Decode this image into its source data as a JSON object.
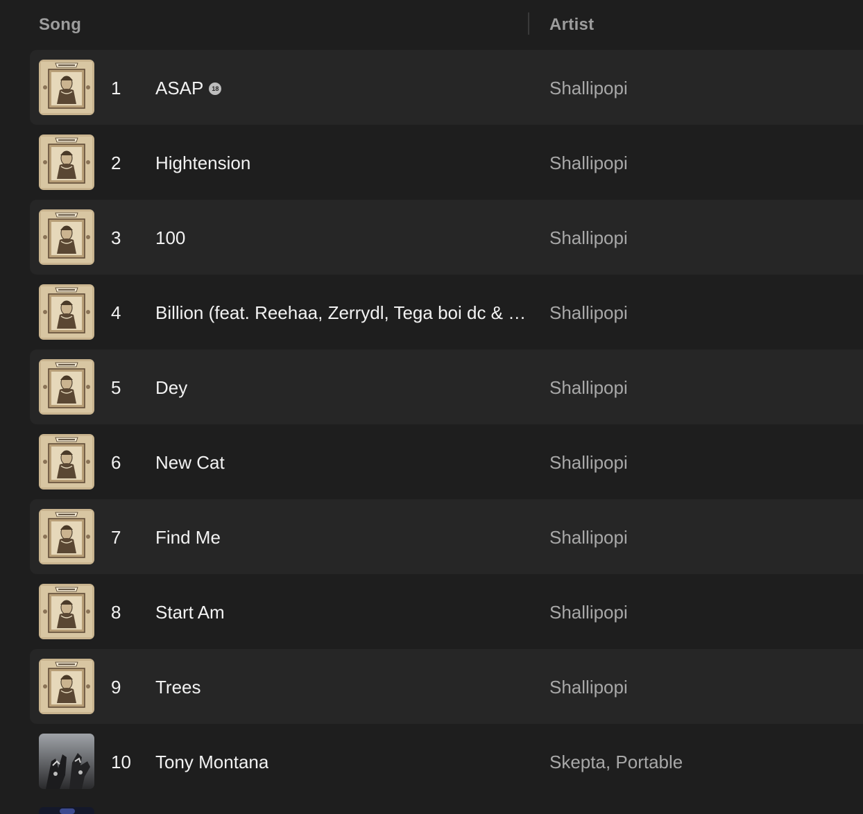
{
  "header": {
    "song_label": "Song",
    "artist_label": "Artist"
  },
  "tracks": [
    {
      "number": "1",
      "title": "ASAP",
      "explicit": true,
      "explicit_label": "18",
      "artist": "Shallipopi",
      "artwork": "shakespeare-cover"
    },
    {
      "number": "2",
      "title": "Hightension",
      "explicit": false,
      "artist": "Shallipopi",
      "artwork": "shakespeare-cover"
    },
    {
      "number": "3",
      "title": "100",
      "explicit": false,
      "artist": "Shallipopi",
      "artwork": "shakespeare-cover"
    },
    {
      "number": "4",
      "title": "Billion (feat. Reehaa, Zerrydl, Tega boi dc & …",
      "explicit": false,
      "artist": "Shallipopi",
      "artwork": "shakespeare-cover"
    },
    {
      "number": "5",
      "title": "Dey",
      "explicit": false,
      "artist": "Shallipopi",
      "artwork": "shakespeare-cover"
    },
    {
      "number": "6",
      "title": "New Cat",
      "explicit": false,
      "artist": "Shallipopi",
      "artwork": "shakespeare-cover"
    },
    {
      "number": "7",
      "title": "Find Me",
      "explicit": false,
      "artist": "Shallipopi",
      "artwork": "shakespeare-cover"
    },
    {
      "number": "8",
      "title": "Start Am",
      "explicit": false,
      "artist": "Shallipopi",
      "artwork": "shakespeare-cover"
    },
    {
      "number": "9",
      "title": "Trees",
      "explicit": false,
      "artist": "Shallipopi",
      "artwork": "shakespeare-cover"
    },
    {
      "number": "10",
      "title": "Tony Montana",
      "explicit": false,
      "artist": "Skepta, Portable",
      "artwork": "hands-photo-cover"
    }
  ],
  "colors": {
    "background": "#1e1e1e",
    "row_alt": "#262626",
    "title_text": "#f2f2f2",
    "artist_text": "#a8a8a8",
    "header_text": "#9d9d9d"
  }
}
